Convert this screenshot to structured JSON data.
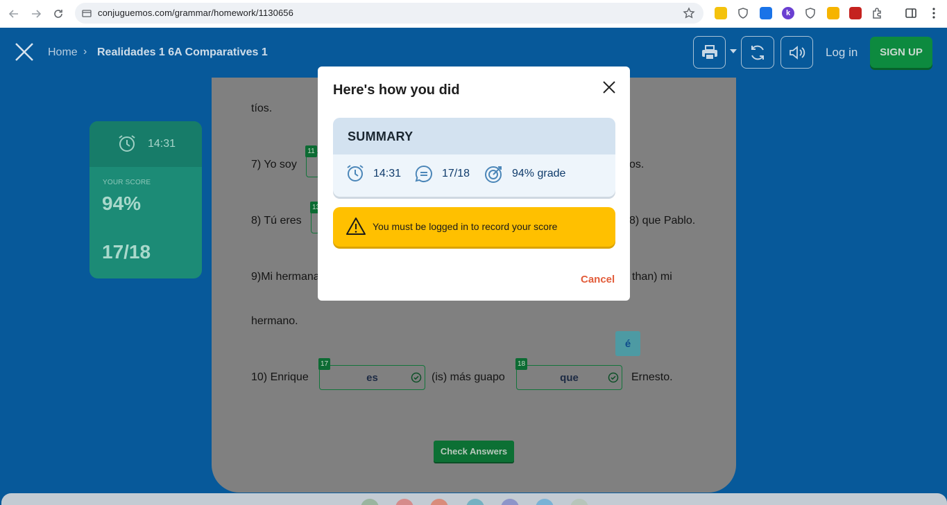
{
  "browser": {
    "url": "conjuguemos.com/grammar/homework/1130656"
  },
  "header": {
    "breadcrumb_home": "Home",
    "breadcrumb_sep": "›",
    "title": "Realidades 1 6A Comparatives 1",
    "login": "Log in",
    "signup": "SIGN UP"
  },
  "score": {
    "time": "14:31",
    "label": "YOUR SCORE",
    "percent": "94%",
    "count": "17/18"
  },
  "worksheet": {
    "line_tios": "tíos.",
    "q7": "7) Yo soy",
    "q7_end": "os.",
    "q7_num": "11",
    "q8": "8) Tú eres",
    "q8_end": "8) que Pablo.",
    "q8_num": "13",
    "q9": "9)Mi hermana",
    "q9_end": "than) mi",
    "q9_cont": "hermano.",
    "q10": "10) Enrique",
    "q10_mid": "(is) más guapo",
    "q10_end": "Ernesto.",
    "ans17": {
      "num": "17",
      "value": "es"
    },
    "ans18": {
      "num": "18",
      "value": "que"
    },
    "accent": "é",
    "check_answers": "Check Answers"
  },
  "modal": {
    "title": "Here's how you did",
    "summary_title": "SUMMARY",
    "time": "14:31",
    "count": "17/18",
    "grade": "94% grade",
    "warning": "You must be logged in to record your score",
    "cancel": "Cancel"
  },
  "colors": {
    "page_bg": "#07599a",
    "score_card": "#1c8b76",
    "warning": "#ffc000",
    "cancel": "#e25c3a",
    "check_button": "#0c7034"
  }
}
